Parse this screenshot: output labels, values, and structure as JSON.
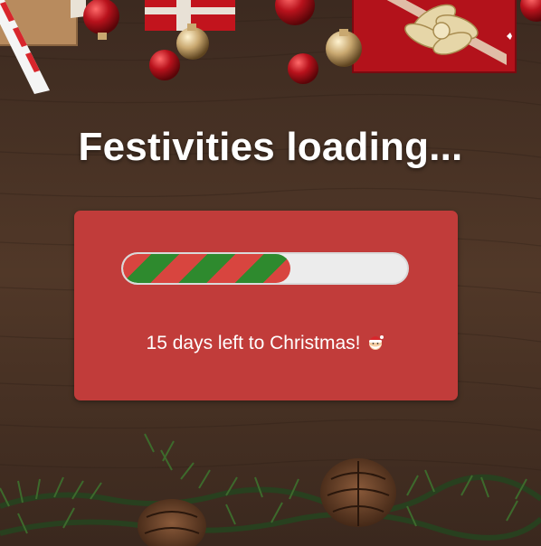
{
  "heading": "Festivities loading...",
  "progress": {
    "fraction": 0.59,
    "stripe_colors": [
      "#d8453f",
      "#2e8a2e"
    ]
  },
  "status_text": "15 days left to Christmas!",
  "status_icon": "santa-face-emoji",
  "colors": {
    "card": "#c13c3a",
    "track": "#ececec",
    "wood": "#4a3326"
  }
}
